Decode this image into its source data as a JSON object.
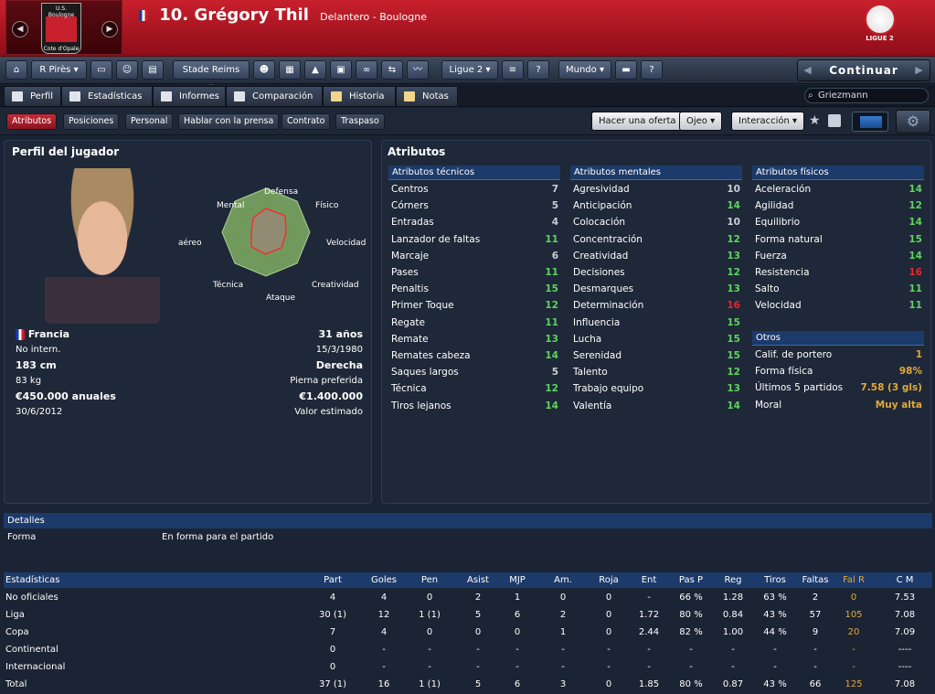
{
  "header": {
    "club_name": "U.S. Boulogne",
    "club_subtitle": "Cote d'Opale",
    "number": "10.",
    "player_name": "Grégory Thil",
    "position": "Delantero - Boulogne",
    "league_logo_text": "LIGUE 2"
  },
  "toolbar": {
    "manager": "R Pirès",
    "club": "Stade Reims",
    "league": "Ligue 2",
    "world": "Mundo",
    "continue": "Continuar"
  },
  "tabs": [
    "Perfil",
    "Estadísticas",
    "Informes",
    "Comparación",
    "Historia",
    "Notas"
  ],
  "search": {
    "value": "Griezmann"
  },
  "subtabs": [
    "Atributos",
    "Posiciones",
    "Personal",
    "Hablar con la prensa",
    "Contrato",
    "Traspaso"
  ],
  "actions": {
    "offer": "Hacer una oferta",
    "scout": "Ojeo",
    "interaction": "Interacción"
  },
  "profile": {
    "title": "Perfil del jugador",
    "radar_labels": [
      "Defensa",
      "Físico",
      "Velocidad",
      "Creatividad",
      "Ataque",
      "Técnica",
      "Juego aéreo",
      "Mental"
    ],
    "nation": "Francia",
    "age": "31 años",
    "caps": "No intern.",
    "dob": "15/3/1980",
    "height": "183 cm",
    "foot": "Derecha",
    "weight": "83 kg",
    "foot_label": "Pierna preferida",
    "wage": "€450.000 anuales",
    "value": "€1.400.000",
    "contract": "30/6/2012",
    "value_label": "Valor estimado"
  },
  "attributes": {
    "title": "Atributos",
    "technical_title": "Atributos técnicos",
    "technical": [
      [
        "Centros",
        "7"
      ],
      [
        "Córners",
        "5"
      ],
      [
        "Entradas",
        "4"
      ],
      [
        "Lanzador de faltas",
        "11"
      ],
      [
        "Marcaje",
        "6"
      ],
      [
        "Pases",
        "11"
      ],
      [
        "Penaltis",
        "15"
      ],
      [
        "Primer Toque",
        "12"
      ],
      [
        "Regate",
        "11"
      ],
      [
        "Remate",
        "13"
      ],
      [
        "Remates cabeza",
        "14"
      ],
      [
        "Saques largos",
        "5"
      ],
      [
        "Técnica",
        "12"
      ],
      [
        "Tiros lejanos",
        "14"
      ]
    ],
    "mental_title": "Atributos mentales",
    "mental": [
      [
        "Agresividad",
        "10"
      ],
      [
        "Anticipación",
        "14"
      ],
      [
        "Colocación",
        "10"
      ],
      [
        "Concentración",
        "12"
      ],
      [
        "Creatividad",
        "13"
      ],
      [
        "Decisiones",
        "12"
      ],
      [
        "Desmarques",
        "13"
      ],
      [
        "Determinación",
        "16"
      ],
      [
        "Influencia",
        "15"
      ],
      [
        "Lucha",
        "15"
      ],
      [
        "Serenidad",
        "15"
      ],
      [
        "Talento",
        "12"
      ],
      [
        "Trabajo equipo",
        "13"
      ],
      [
        "Valentía",
        "14"
      ]
    ],
    "physical_title": "Atributos físicos",
    "physical": [
      [
        "Aceleración",
        "14"
      ],
      [
        "Agilidad",
        "12"
      ],
      [
        "Equilibrio",
        "14"
      ],
      [
        "Forma natural",
        "15"
      ],
      [
        "Fuerza",
        "14"
      ],
      [
        "Resistencia",
        "16"
      ],
      [
        "Salto",
        "11"
      ],
      [
        "Velocidad",
        "11"
      ]
    ],
    "other_title": "Otros",
    "other": [
      [
        "Calif. de portero",
        "1"
      ],
      [
        "Forma física",
        "98%"
      ],
      [
        "Últimos 5 partidos",
        "7.58 (3 gls)"
      ],
      [
        "Moral",
        "Muy alta"
      ]
    ]
  },
  "details": {
    "title": "Detalles",
    "form_label": "Forma",
    "form_value": "En forma para el partido"
  },
  "stats": {
    "headers": [
      "Estadísticas",
      "Part",
      "Goles",
      "Pen",
      "Asist",
      "MJP",
      "Am.",
      "Roja",
      "Ent",
      "Pas P",
      "Reg",
      "Tiros",
      "Faltas",
      "Fal R",
      "C M"
    ],
    "rows": [
      [
        "No oficiales",
        "4",
        "4",
        "0",
        "2",
        "1",
        "0",
        "0",
        "-",
        "66 %",
        "1.28",
        "63 %",
        "2",
        "0",
        "7.53"
      ],
      [
        "Liga",
        "30 (1)",
        "12",
        "1 (1)",
        "5",
        "6",
        "2",
        "0",
        "1.72",
        "80 %",
        "0.84",
        "43 %",
        "57",
        "105",
        "7.08"
      ],
      [
        "Copa",
        "7",
        "4",
        "0",
        "0",
        "0",
        "1",
        "0",
        "2.44",
        "82 %",
        "1.00",
        "44 %",
        "9",
        "20",
        "7.09"
      ],
      [
        "Continental",
        "0",
        "-",
        "-",
        "-",
        "-",
        "-",
        "-",
        "-",
        "-",
        "-",
        "-",
        "-",
        "-",
        "----"
      ],
      [
        "Internacional",
        "0",
        "-",
        "-",
        "-",
        "-",
        "-",
        "-",
        "-",
        "-",
        "-",
        "-",
        "-",
        "-",
        "----"
      ],
      [
        "Total",
        "37 (1)",
        "16",
        "1 (1)",
        "5",
        "6",
        "3",
        "0",
        "1.85",
        "80 %",
        "0.87",
        "43 %",
        "66",
        "125",
        "7.08"
      ]
    ]
  },
  "colors": {
    "green": "#5fd35f",
    "red": "#e52828",
    "gold": "#e2a83a",
    "header_red": "#c8202c",
    "section_blue": "#1c3a6a"
  }
}
